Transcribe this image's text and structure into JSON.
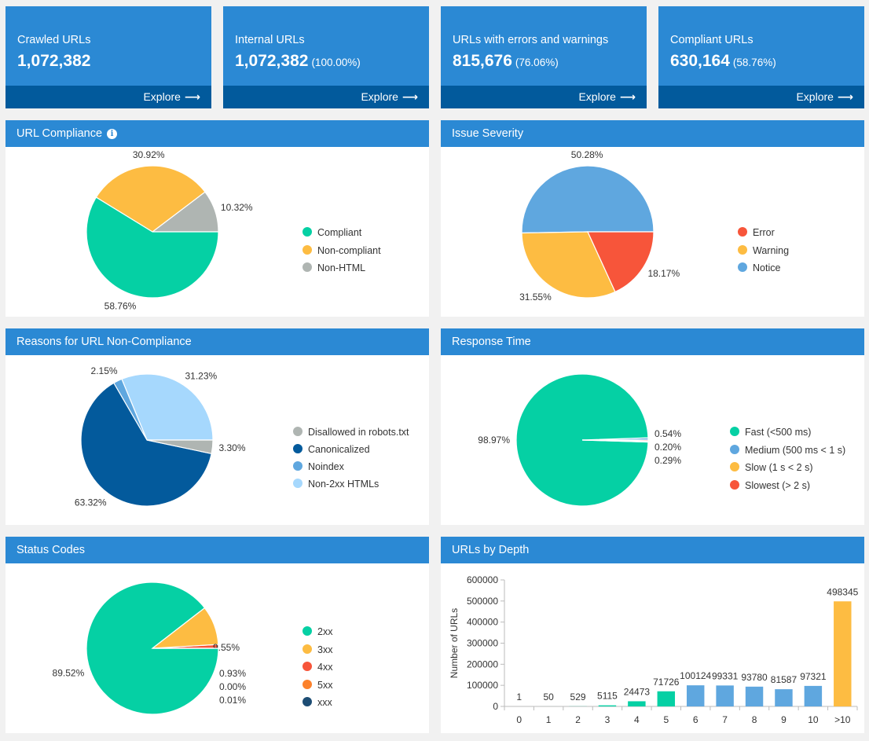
{
  "cards": [
    {
      "title": "Crawled URLs",
      "value": "1,072,382",
      "pct": "",
      "explore": "Explore"
    },
    {
      "title": "Internal URLs",
      "value": "1,072,382",
      "pct": "(100.00%)",
      "explore": "Explore"
    },
    {
      "title": "URLs with errors and warnings",
      "value": "815,676",
      "pct": "(76.06%)",
      "explore": "Explore"
    },
    {
      "title": "Compliant URLs",
      "value": "630,164",
      "pct": "(58.76%)",
      "explore": "Explore"
    }
  ],
  "explore_arrow": "⟶",
  "info_icon": "i",
  "colors": {
    "header_blue": "#2b89d4",
    "footer_blue": "#025a9c",
    "green": "#05d0a4",
    "yellow": "#fdbc42",
    "gray": "#afb5b2",
    "red": "#f7553a",
    "lightblue": "#5fa7df",
    "darkblue": "#035a9c",
    "paleblue": "#a6d8fd",
    "orange": "#fc822c",
    "navy": "#1d4d74"
  },
  "chart_data": [
    {
      "id": "url-compliance",
      "type": "pie",
      "title": "URL Compliance",
      "has_info_icon": true,
      "slices": [
        {
          "label": "Non-HTML",
          "value": 10.32,
          "display": "10.32%",
          "color": "#afb5b2"
        },
        {
          "label": "Non-compliant",
          "value": 30.92,
          "display": "30.92%",
          "color": "#fdbc42"
        },
        {
          "label": "Compliant",
          "value": 58.76,
          "display": "58.76%",
          "color": "#05d0a4"
        }
      ],
      "legend": [
        {
          "label": "Compliant",
          "color": "#05d0a4"
        },
        {
          "label": "Non-compliant",
          "color": "#fdbc42"
        },
        {
          "label": "Non-HTML",
          "color": "#afb5b2"
        }
      ],
      "legend_placement": "right"
    },
    {
      "id": "issue-severity",
      "type": "pie",
      "title": "Issue Severity",
      "slices": [
        {
          "label": "Notice",
          "value": 50.28,
          "display": "50.28%",
          "color": "#5fa7df"
        },
        {
          "label": "Warning",
          "value": 31.55,
          "display": "31.55%",
          "color": "#fdbc42"
        },
        {
          "label": "Error",
          "value": 18.17,
          "display": "18.17%",
          "color": "#f7553a"
        }
      ],
      "legend": [
        {
          "label": "Error",
          "color": "#f7553a"
        },
        {
          "label": "Warning",
          "color": "#fdbc42"
        },
        {
          "label": "Notice",
          "color": "#5fa7df"
        }
      ],
      "legend_placement": "right"
    },
    {
      "id": "non-compliance-reasons",
      "type": "pie",
      "title": "Reasons for URL Non-Compliance",
      "slices": [
        {
          "label": "Non-2xx HTMLs",
          "value": 31.23,
          "display": "31.23%",
          "color": "#a6d8fd"
        },
        {
          "label": "Noindex",
          "value": 2.15,
          "display": "2.15%",
          "color": "#5fa7df"
        },
        {
          "label": "Canonicalized",
          "value": 63.32,
          "display": "63.32%",
          "color": "#035a9c"
        },
        {
          "label": "Disallowed in robots.txt",
          "value": 3.3,
          "display": "3.30%",
          "color": "#afb5b2"
        }
      ],
      "legend": [
        {
          "label": "Disallowed in robots.txt",
          "color": "#afb5b2"
        },
        {
          "label": "Canonicalized",
          "color": "#035a9c"
        },
        {
          "label": "Noindex",
          "color": "#5fa7df"
        },
        {
          "label": "Non-2xx HTMLs",
          "color": "#a6d8fd"
        }
      ],
      "legend_placement": "right"
    },
    {
      "id": "response-time",
      "type": "pie",
      "title": "Response Time",
      "slices": [
        {
          "label": "Medium (500 ms < 1 s)",
          "value": 0.54,
          "display": "0.54%",
          "color": "#5fa7df"
        },
        {
          "label": "Fast (<500 ms)",
          "value": 98.97,
          "display": "98.97%",
          "color": "#05d0a4"
        },
        {
          "label": "Slow (1 s < 2 s)",
          "value": 0.2,
          "display": "0.20%",
          "color": "#fdbc42"
        },
        {
          "label": "Slowest (> 2 s)",
          "value": 0.29,
          "display": "0.29%",
          "color": "#f7553a"
        }
      ],
      "legend": [
        {
          "label": "Fast (<500 ms)",
          "color": "#05d0a4"
        },
        {
          "label": "Medium (500 ms < 1 s)",
          "color": "#5fa7df"
        },
        {
          "label": "Slow (1 s < 2 s)",
          "color": "#fdbc42"
        },
        {
          "label": "Slowest (> 2 s)",
          "color": "#f7553a"
        }
      ],
      "legend_placement": "right"
    },
    {
      "id": "status-codes",
      "type": "pie",
      "title": "Status Codes",
      "slices": [
        {
          "label": "4xx",
          "value": 0.93,
          "display": "0.93%",
          "color": "#f7553a"
        },
        {
          "label": "3xx",
          "value": 9.55,
          "display": "9.55%",
          "color": "#fdbc42"
        },
        {
          "label": "2xx",
          "value": 89.52,
          "display": "89.52%",
          "color": "#05d0a4"
        },
        {
          "label": "5xx",
          "value": 0.0,
          "display": "0.00%",
          "color": "#fc822c"
        },
        {
          "label": "xxx",
          "value": 0.01,
          "display": "0.01%",
          "color": "#1d4d74"
        }
      ],
      "legend": [
        {
          "label": "2xx",
          "color": "#05d0a4"
        },
        {
          "label": "3xx",
          "color": "#fdbc42"
        },
        {
          "label": "4xx",
          "color": "#f7553a"
        },
        {
          "label": "5xx",
          "color": "#fc822c"
        },
        {
          "label": "xxx",
          "color": "#1d4d74"
        }
      ],
      "legend_placement": "right"
    },
    {
      "id": "urls-by-depth",
      "type": "bar",
      "title": "URLs by Depth",
      "xlabel": "",
      "ylabel": "Number of URLs",
      "ylim": [
        0,
        600000
      ],
      "yticks": [
        0,
        100000,
        200000,
        300000,
        400000,
        500000,
        600000
      ],
      "categories": [
        "0",
        "1",
        "2",
        "3",
        "4",
        "5",
        "6",
        "7",
        "8",
        "9",
        "10",
        ">10"
      ],
      "values": [
        1,
        50,
        529,
        5115,
        24473,
        71726,
        100124,
        99331,
        93780,
        81587,
        97321,
        498345
      ],
      "bar_colors": [
        "#05d0a4",
        "#05d0a4",
        "#05d0a4",
        "#05d0a4",
        "#05d0a4",
        "#05d0a4",
        "#5fa7df",
        "#5fa7df",
        "#5fa7df",
        "#5fa7df",
        "#5fa7df",
        "#fdbc42"
      ],
      "grid": false,
      "legend": "none"
    }
  ]
}
